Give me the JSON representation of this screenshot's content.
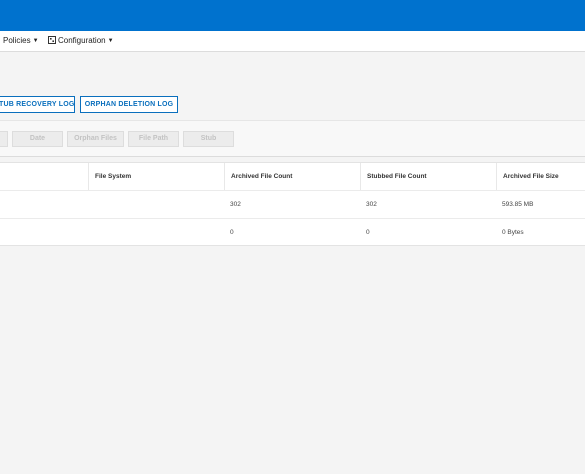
{
  "nav": {
    "policies": "Policies",
    "configuration": "Configuration"
  },
  "log_buttons": {
    "stub_recovery": "TUB RECOVERY LOG",
    "orphan_deletion": "ORPHAN DELETION LOG"
  },
  "filters": [
    "Date",
    "Orphan Files",
    "File Path",
    "Stub"
  ],
  "table": {
    "columns": [
      "File System",
      "Archived File Count",
      "Stubbed File Count",
      "Archived File Size"
    ],
    "rows": [
      [
        "",
        "302",
        "302",
        "593.85 MB"
      ],
      [
        "",
        "0",
        "0",
        "0 Bytes"
      ]
    ]
  },
  "colors": {
    "accent": "#0072ce",
    "button_border": "#0a6fbd"
  },
  "icons": {
    "configuration": "config-icon",
    "dropdown": "caret-down-icon"
  }
}
